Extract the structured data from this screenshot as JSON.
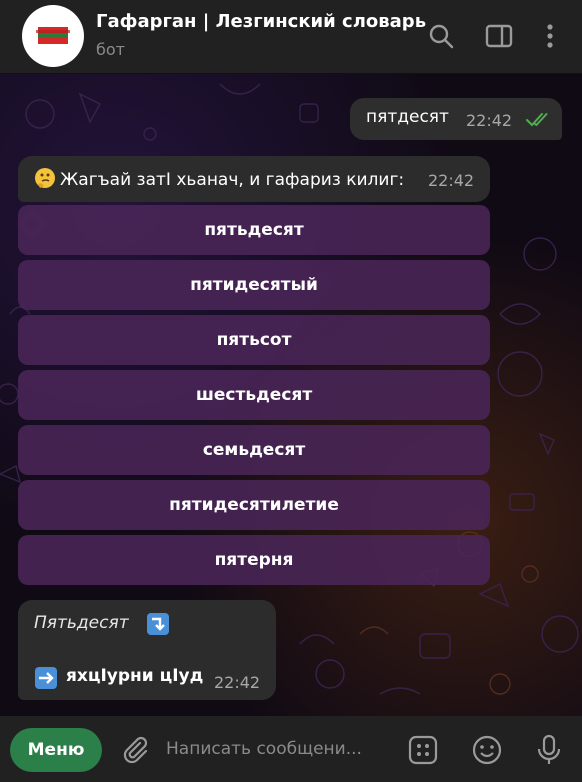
{
  "header": {
    "title": "Гафарган | Лезгинский словарь",
    "subtitle": "бот",
    "icons": [
      "search-icon",
      "sidebar-toggle-icon",
      "more-vertical-icon"
    ]
  },
  "messages": {
    "outgoing": {
      "text": "пятдесят",
      "time": "22:42",
      "status": "read"
    },
    "prompt": {
      "emoji": "thinking-face",
      "text": "Жагъай затӀ хьанач, и гафариз килиг:",
      "time": "22:42"
    },
    "keyboard": [
      "пятьдесят",
      "пятидесятый",
      "пятьсот",
      "шестьдесят",
      "семьдесят",
      "пятидесятилетие",
      "пятерня"
    ],
    "result": {
      "word": "Пятьдесят",
      "word_emoji": "arrow-right-down-emoji",
      "line_emoji": "arrow-right-emoji",
      "translation": "яхцӀурни цӀуд",
      "time": "22:42"
    }
  },
  "composer": {
    "menu_label": "Меню",
    "placeholder": "Написать сообщени...",
    "icons": [
      "attach-icon",
      "bot-commands-icon",
      "emoji-icon",
      "microphone-icon"
    ]
  },
  "colors": {
    "header_bg": "#212121",
    "bubble_bg": "#2c2c2c",
    "keyboard_bg": "#4a2658",
    "menu_bg": "#2b7f48",
    "read_ticks": "#4fae4e"
  }
}
